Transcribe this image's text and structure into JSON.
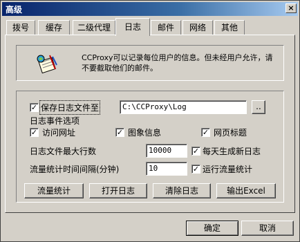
{
  "window": {
    "title": "高级",
    "close": "×"
  },
  "tabs": [
    "拨号",
    "缓存",
    "二级代理",
    "日志",
    "邮件",
    "网络",
    "其他"
  ],
  "active_tab": "日志",
  "info": {
    "icon": "log-notebook-icon",
    "text": "CCProxy可以记录每位用户的信息。但未经用户允许，请不要截取他们的邮件。"
  },
  "log": {
    "save_log_label": "保存日志文件至",
    "save_log_checked": true,
    "path": "C:\\CCProxy\\Log",
    "browse_label": "..",
    "events_label": "日志事件选项",
    "events": [
      {
        "label": "访问网址",
        "checked": true
      },
      {
        "label": "图象信息",
        "checked": true
      },
      {
        "label": "网页标题",
        "checked": true
      }
    ],
    "max_lines_label": "日志文件最大行数",
    "max_lines": "10000",
    "daily_new_label": "每天生成新日志",
    "daily_new_checked": true,
    "interval_label": "流量统计时间间隔(分钟)",
    "interval": "10",
    "run_stats_label": "运行流量统计",
    "run_stats_checked": true
  },
  "buttons": {
    "traffic": "流量统计",
    "open_log": "打开日志",
    "clear_log": "清除日志",
    "export_excel": "输出Excel"
  },
  "footer": {
    "ok": "确定",
    "cancel": "取消"
  }
}
